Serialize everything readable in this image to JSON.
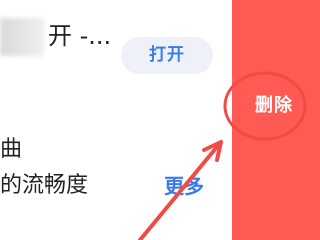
{
  "app_item": {
    "title_fragment": "开 -...",
    "open_label": "打开"
  },
  "details": {
    "line_1": "曲",
    "line_2": "的流畅度",
    "more_label": "更多"
  },
  "swipe_action": {
    "delete_label": "删除"
  },
  "colors": {
    "delete_bg": "#ff5a54",
    "annotation_red": "#f24b45",
    "button_blue": "#3b7be8",
    "button_bg": "#eef2f8"
  },
  "annotations": {
    "highlight_circle": "red-circle",
    "pointer_arrow": "red-arrow"
  }
}
